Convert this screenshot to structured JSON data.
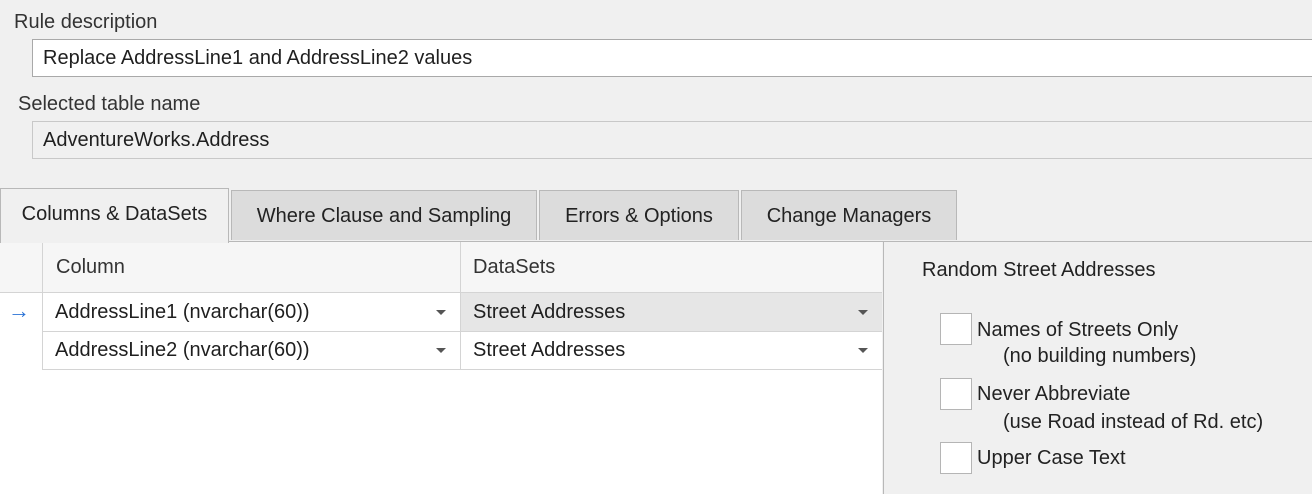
{
  "rule_description": {
    "label": "Rule description",
    "value": "Replace AddressLine1 and AddressLine2 values"
  },
  "selected_table": {
    "label": "Selected table name",
    "value": "AdventureWorks.Address"
  },
  "tabs": [
    {
      "label": "Columns & DataSets",
      "active": true
    },
    {
      "label": "Where Clause and Sampling",
      "active": false
    },
    {
      "label": "Errors & Options",
      "active": false
    },
    {
      "label": "Change Managers",
      "active": false
    }
  ],
  "grid": {
    "headers": [
      "Column",
      "DataSets"
    ],
    "current_row_indicator": "→",
    "rows": [
      {
        "column": "AddressLine1  (nvarchar(60))",
        "dataset": "Street Addresses",
        "selected": true
      },
      {
        "column": "AddressLine2  (nvarchar(60))",
        "dataset": "Street Addresses",
        "selected": false
      }
    ]
  },
  "panel": {
    "title": "Random Street Addresses",
    "options": [
      {
        "label": "Names of Streets Only",
        "sublabel": "(no building numbers)",
        "checked": false
      },
      {
        "label": "Never Abbreviate",
        "sublabel": "(use Road instead of Rd. etc)",
        "checked": false
      },
      {
        "label": "Upper Case Text",
        "sublabel": "",
        "checked": false
      }
    ]
  },
  "colors": {
    "accent_arrow": "#2b73d6",
    "selected_cell_bg": "#e6e6e6"
  }
}
